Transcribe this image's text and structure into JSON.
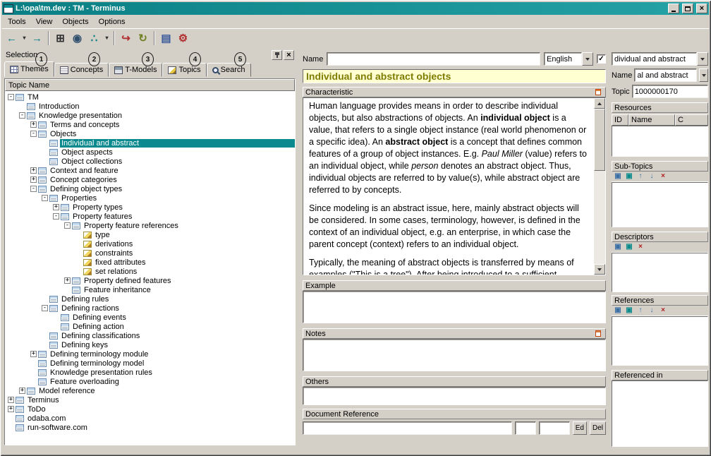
{
  "window": {
    "title": "L:\\opa\\tm.dev : TM - Terminus",
    "menu": [
      "Tools",
      "View",
      "Objects",
      "Options"
    ]
  },
  "toolbar": {
    "buttons": [
      {
        "name": "back-icon",
        "glyph": "←",
        "color": "#0a7f84"
      },
      {
        "name": "back-history-icon",
        "glyph": "▾",
        "color": "#303030",
        "small": true
      },
      {
        "name": "forward-icon",
        "glyph": "→",
        "color": "#0a7f84"
      },
      {
        "sep": true
      },
      {
        "name": "tree-view-icon",
        "glyph": "⊞",
        "color": "#303030"
      },
      {
        "name": "globe-icon",
        "glyph": "◉",
        "color": "#30506e"
      },
      {
        "name": "relations-icon",
        "glyph": "∴",
        "color": "#0a7f84"
      },
      {
        "name": "relations-history-icon",
        "glyph": "▾",
        "color": "#303030",
        "small": true
      },
      {
        "sep": true
      },
      {
        "name": "import-icon",
        "glyph": "↪",
        "color": "#b03030"
      },
      {
        "name": "refresh-icon",
        "glyph": "↻",
        "color": "#6e8020"
      },
      {
        "sep": true
      },
      {
        "name": "report-icon",
        "glyph": "▤",
        "color": "#3a5a9a"
      },
      {
        "name": "process-icon",
        "glyph": "⚙",
        "color": "#b03030"
      }
    ]
  },
  "selection": {
    "title": "Selection",
    "tabs": [
      {
        "label": "Themes",
        "icon": "themes",
        "annotation": "1",
        "active": true
      },
      {
        "label": "Concepts",
        "icon": "concepts",
        "annotation": "2"
      },
      {
        "label": "T-Models",
        "icon": "tmodels",
        "annotation": "3"
      },
      {
        "label": "Topics",
        "icon": "topics",
        "annotation": "4"
      },
      {
        "label": "Search",
        "icon": "search",
        "annotation": "5"
      }
    ]
  },
  "tree": {
    "header": "Topic Name",
    "items": [
      {
        "label": "TM",
        "depth": 0,
        "expander": "minus",
        "icon": "topic"
      },
      {
        "label": "Introduction",
        "depth": 1,
        "expander": "none",
        "icon": "topic"
      },
      {
        "label": "Knowledge presentation",
        "depth": 1,
        "expander": "minus",
        "icon": "topic"
      },
      {
        "label": "Terms and concepts",
        "depth": 2,
        "expander": "plus",
        "icon": "topic"
      },
      {
        "label": "Objects",
        "depth": 2,
        "expander": "minus",
        "icon": "topic"
      },
      {
        "label": "Individual and abstract",
        "depth": 3,
        "expander": "none",
        "icon": "topic",
        "selected": true
      },
      {
        "label": "Object aspects",
        "depth": 3,
        "expander": "none",
        "icon": "topic"
      },
      {
        "label": "Object collections",
        "depth": 3,
        "expander": "none",
        "icon": "topic"
      },
      {
        "label": "Context and feature",
        "depth": 2,
        "expander": "plus",
        "icon": "topic"
      },
      {
        "label": "Concept categories",
        "depth": 2,
        "expander": "plus",
        "icon": "topic"
      },
      {
        "label": "Defining object types",
        "depth": 2,
        "expander": "minus",
        "icon": "topic"
      },
      {
        "label": "Properties",
        "depth": 3,
        "expander": "minus",
        "icon": "topic"
      },
      {
        "label": "Property types",
        "depth": 4,
        "expander": "plus",
        "icon": "topic"
      },
      {
        "label": "Property features",
        "depth": 4,
        "expander": "minus",
        "icon": "topic"
      },
      {
        "label": "Property feature references",
        "depth": 5,
        "expander": "minus",
        "icon": "topic"
      },
      {
        "label": "type",
        "depth": 6,
        "expander": "none",
        "icon": "attr"
      },
      {
        "label": "derivations",
        "depth": 6,
        "expander": "none",
        "icon": "attr"
      },
      {
        "label": "constraints",
        "depth": 6,
        "expander": "none",
        "icon": "attr"
      },
      {
        "label": "fixed attributes",
        "depth": 6,
        "expander": "none",
        "icon": "attr"
      },
      {
        "label": "set relations",
        "depth": 6,
        "expander": "none",
        "icon": "attr"
      },
      {
        "label": "Property defined features",
        "depth": 5,
        "expander": "plus",
        "icon": "topic"
      },
      {
        "label": "Feature inheritance",
        "depth": 5,
        "expander": "none",
        "icon": "topic"
      },
      {
        "label": "Defining rules",
        "depth": 3,
        "expander": "none",
        "icon": "topic"
      },
      {
        "label": "Defining ractions",
        "depth": 3,
        "expander": "minus",
        "icon": "topic"
      },
      {
        "label": "Defining events",
        "depth": 4,
        "expander": "none",
        "icon": "topic"
      },
      {
        "label": "Defining action",
        "depth": 4,
        "expander": "none",
        "icon": "topic"
      },
      {
        "label": "Defining classifications",
        "depth": 3,
        "expander": "none",
        "icon": "topic"
      },
      {
        "label": "Defining keys",
        "depth": 3,
        "expander": "none",
        "icon": "topic"
      },
      {
        "label": "Defining terminology module",
        "depth": 2,
        "expander": "plus",
        "icon": "topic"
      },
      {
        "label": "Defining terminology model",
        "depth": 2,
        "expander": "none",
        "icon": "topic"
      },
      {
        "label": "Knowledge presentation rules",
        "depth": 2,
        "expander": "none",
        "icon": "topic"
      },
      {
        "label": "Feature overloading",
        "depth": 2,
        "expander": "none",
        "icon": "topic"
      },
      {
        "label": "Model reference",
        "depth": 1,
        "expander": "plus",
        "icon": "topic"
      },
      {
        "label": "Terminus",
        "depth": 0,
        "expander": "plus",
        "icon": "topic"
      },
      {
        "label": "ToDo",
        "depth": 0,
        "expander": "plus",
        "icon": "topic"
      },
      {
        "label": "odaba.com",
        "depth": 0,
        "expander": "none",
        "icon": "topic"
      },
      {
        "label": "run-software.com",
        "depth": 0,
        "expander": "none",
        "icon": "topic"
      }
    ]
  },
  "detail": {
    "name_label": "Name",
    "name_value": "",
    "language_value": "English",
    "language_checked": true,
    "title": "Individual and abstract objects",
    "characteristic_label": "Characteristic",
    "characteristic_paragraphs": [
      [
        {
          "t": "Human language provides means in order to describe individual objects, but also abstractions of objects. An "
        },
        {
          "t": "individual object",
          "b": true
        },
        {
          "t": " is a value, that refers to a single object instance (real world phenomenon or a specific idea). An "
        },
        {
          "t": "abstract object",
          "b": true
        },
        {
          "t": " is a concept that defines common features of a group of object instances. E.g. "
        },
        {
          "t": "Paul Miller",
          "i": true
        },
        {
          "t": " (value) refers to an individual object, while "
        },
        {
          "t": "person",
          "i": true
        },
        {
          "t": " denotes an abstract object. Thus, individual objects are referred to by value(s), while abstract object are referred to by concepts."
        }
      ],
      [
        {
          "t": "Since modeling is an abstract issue, here, mainly abstract objects will be considered. In some cases, terminology, however, is defined in the context of an individual object, e.g. an enterprise, in which case the parent concept (context) refers to an individual object."
        }
      ],
      [
        {
          "t": "Typically, the meaning of abstract objects is transferred by means of examples (\"This is a tree\"). After being introduced to a sufficient"
        }
      ]
    ],
    "example_label": "Example",
    "example_value": "",
    "notes_label": "Notes",
    "notes_value": "",
    "others_label": "Others",
    "others_value": "",
    "docref_label": "Document Reference",
    "docref_value": "",
    "docref_field2": "",
    "docref_field3": "",
    "edit_button": "Ed",
    "delete_button": "Del"
  },
  "sidebar": {
    "topic_combo_value": "dividual and abstract",
    "name_label": "Name",
    "name_value": "al and abstract",
    "topic_label": "Topic",
    "topic_value": "1000000170",
    "resources_label": "Resources",
    "resources_columns": [
      "ID",
      "Name",
      "C"
    ],
    "subtopics_label": "Sub-Topics",
    "subtopics_tools": [
      "add",
      "link",
      "move-up",
      "move-down",
      "delete"
    ],
    "descriptors_label": "Descriptors",
    "descriptors_tools": [
      "add",
      "link",
      "delete"
    ],
    "references_label": "References",
    "references_tools": [
      "add",
      "link",
      "move-up",
      "move-down",
      "delete"
    ],
    "referenced_in_label": "Referenced in"
  },
  "colors": {
    "titlebar": "#0a7f84",
    "titlebar_light": "#25a2a6",
    "selection_highlight": "#0a8a8e",
    "heading_bg": "#ffffd2",
    "heading_fg": "#7f7d00"
  }
}
